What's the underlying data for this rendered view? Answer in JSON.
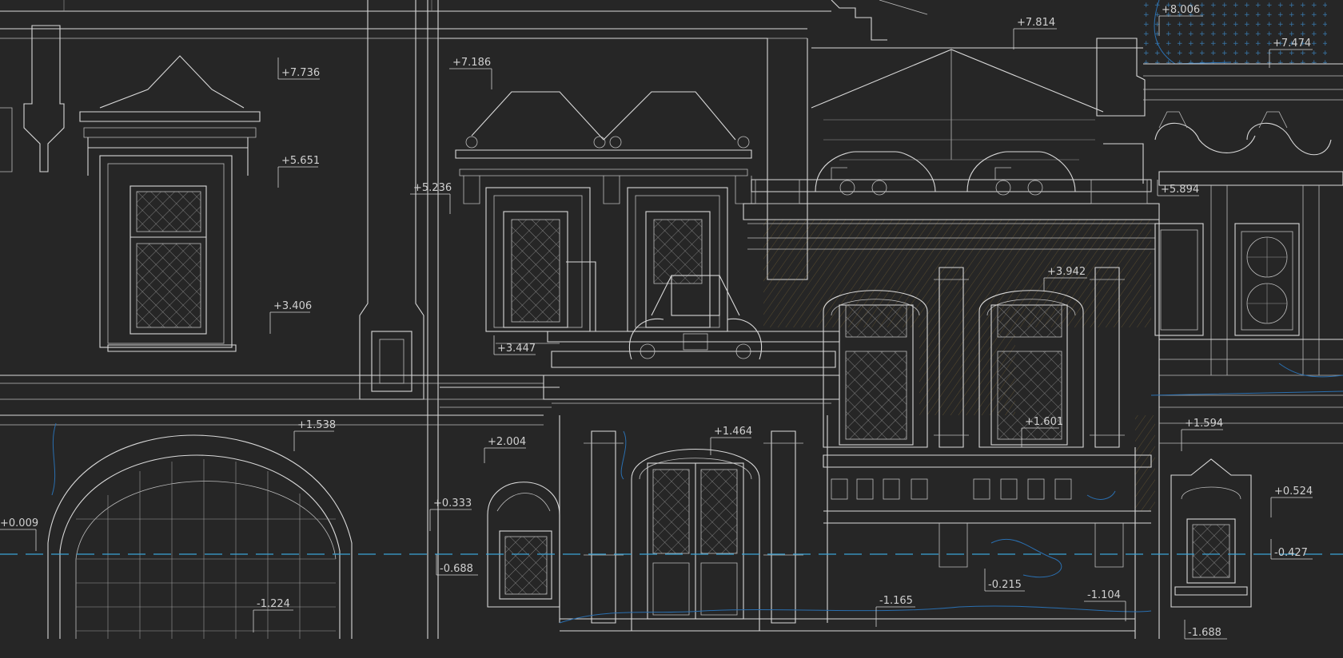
{
  "colors": {
    "background": "#262626",
    "linework": "#d9d9d9",
    "hatch": "#a8843a",
    "blue_lines": "#2a6fb0",
    "axis_line": "#3aa3d6"
  },
  "levels": {
    "l1": "+8.006",
    "l2": "+7.814",
    "l3": "+7.474",
    "l4": "+7.736",
    "l5": "+7.186",
    "l6": "+5.651",
    "l7": "+5.236",
    "l8": "+5.894",
    "l9": "+3.942",
    "l10": "+3.406",
    "l11": "+3.447",
    "l12": "+1.538",
    "l13": "+1.464",
    "l14": "+1.601",
    "l15": "+1.594",
    "l16": "+2.004",
    "l17": "+0.333",
    "l18": "+0.009",
    "l19": "+0.524",
    "l20": "-0.688",
    "l21": "-0.215",
    "l22": "-0.427",
    "l23": "-1.224",
    "l24": "-1.165",
    "l25": "-1.104",
    "l26": "-1.688"
  }
}
